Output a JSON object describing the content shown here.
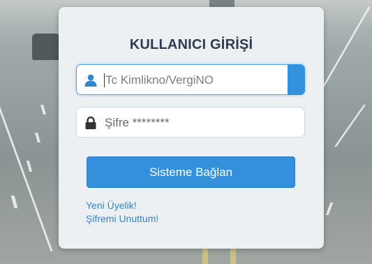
{
  "login": {
    "title": "KULLANICI GİRİŞİ",
    "username_placeholder": "Tc Kimlikno/VergiNO",
    "password_placeholder": "Şifre ********",
    "submit_label": "Sisteme Bağlan",
    "register_link": "Yeni Üyelik!",
    "forgot_link": "Şifremi Unuttum!"
  },
  "colors": {
    "accent": "#3490db",
    "title": "#2d3e50",
    "link": "#2f86cf",
    "card": "#edf0f2"
  },
  "icons": {
    "username": "user-icon",
    "password": "lock-icon"
  }
}
